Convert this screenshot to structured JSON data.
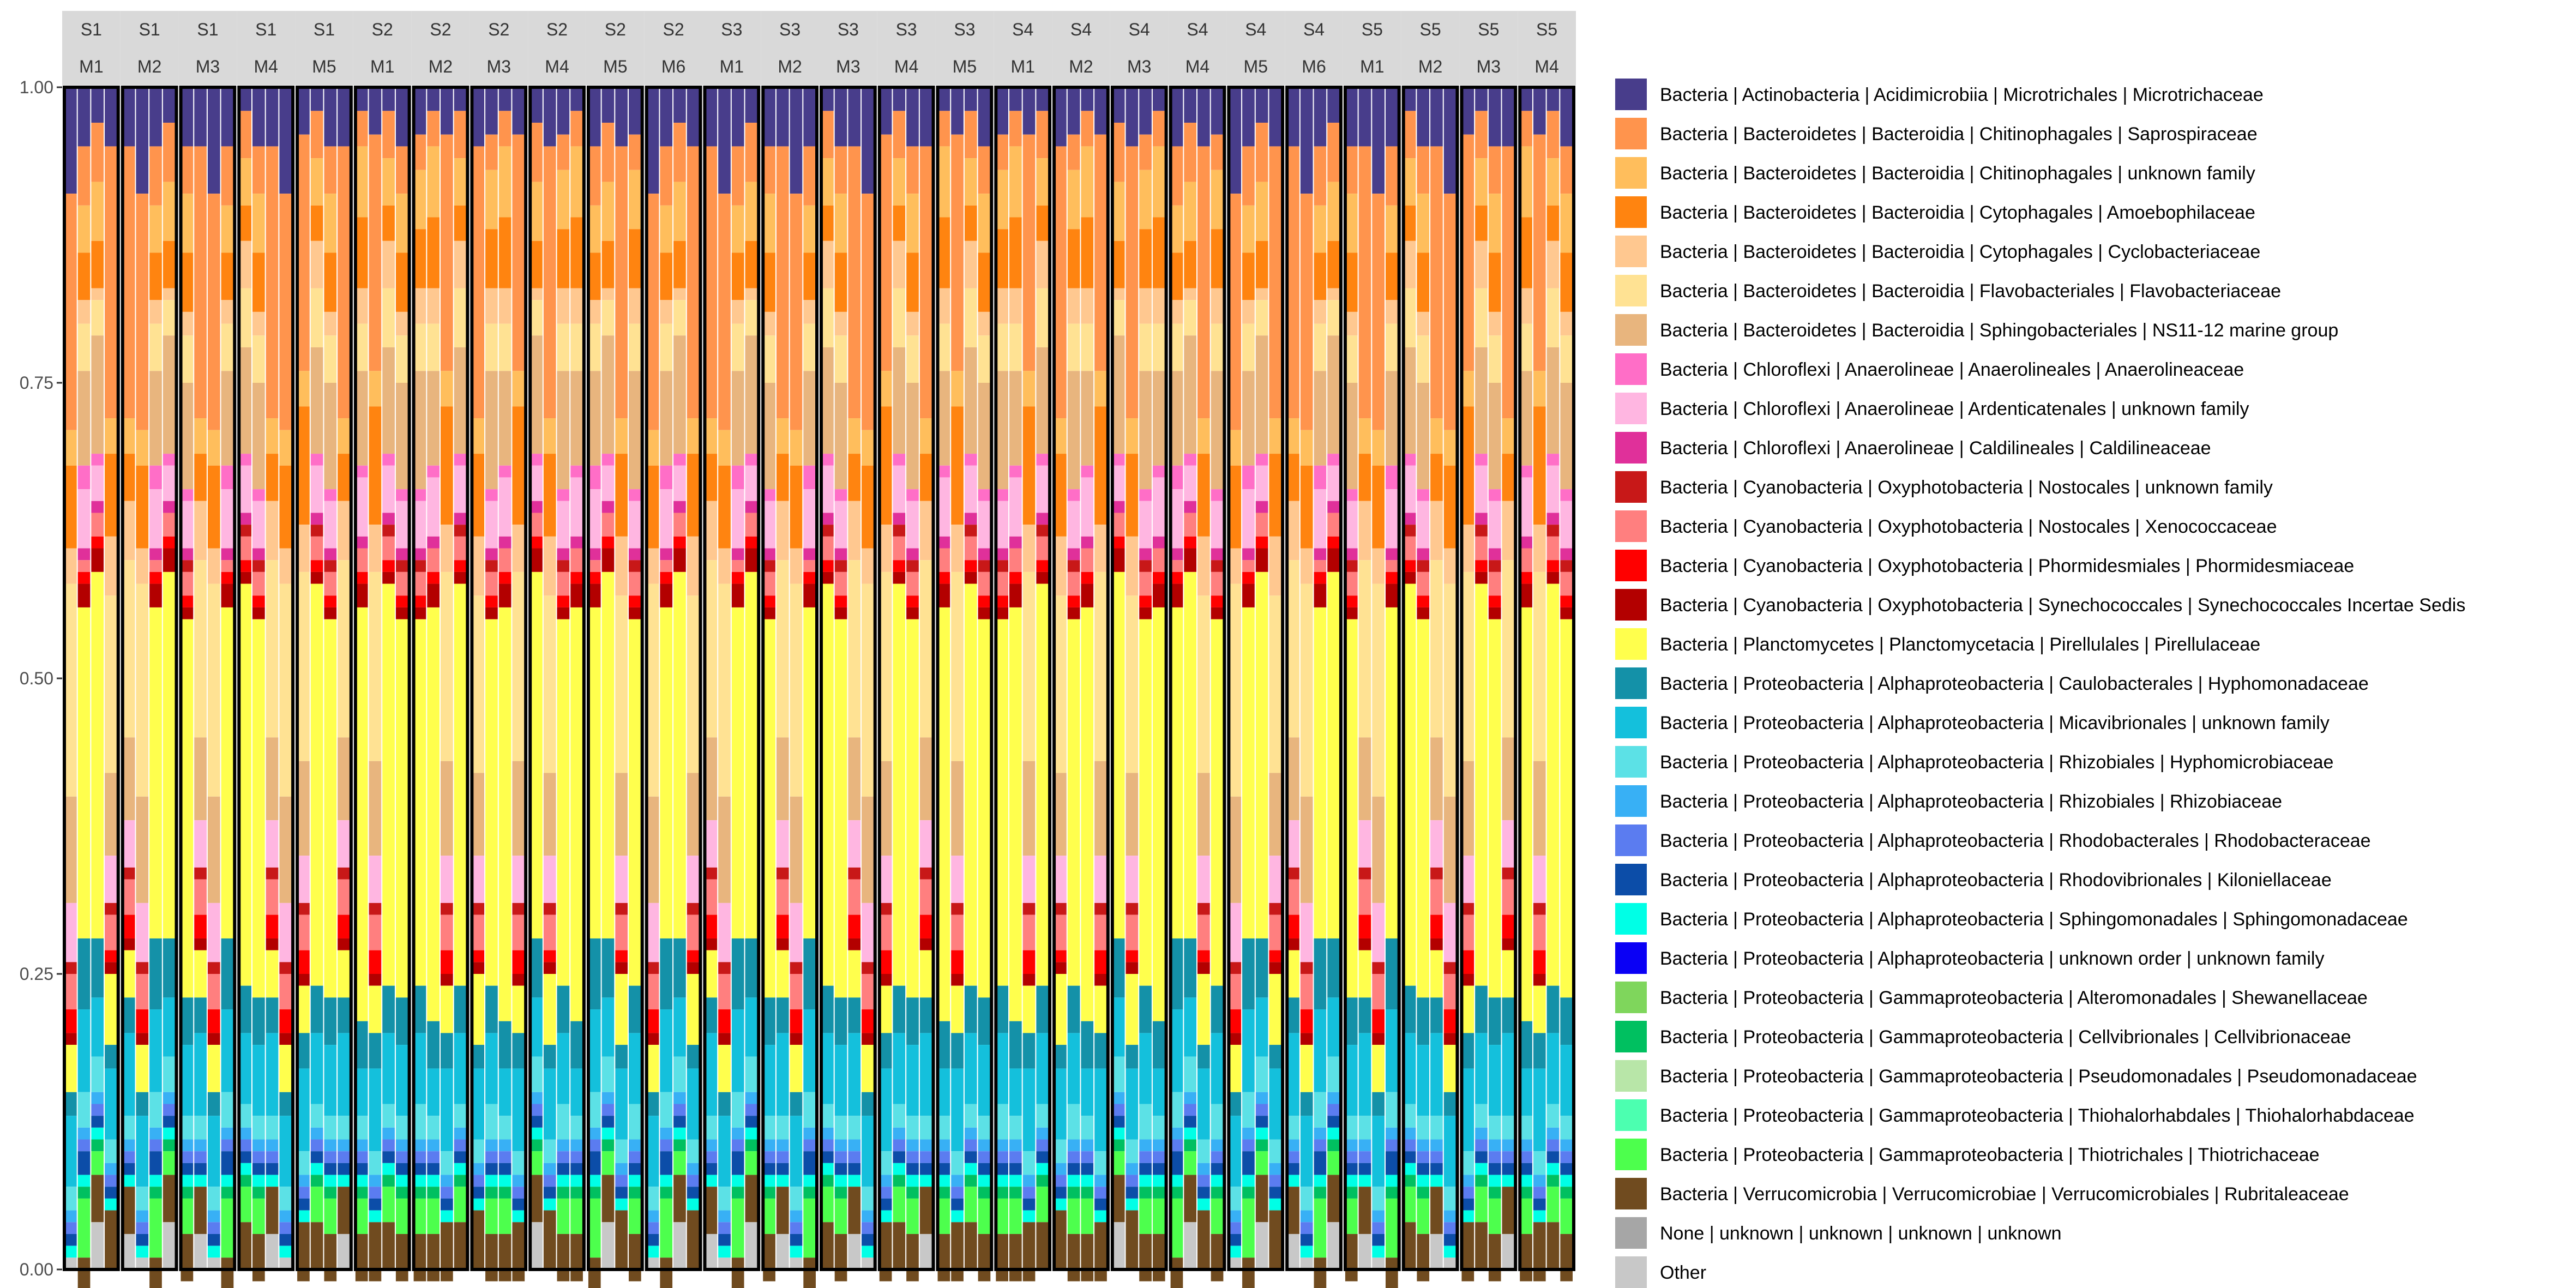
{
  "chart_data": {
    "type": "bar",
    "stacked": true,
    "ylim": [
      0,
      1
    ],
    "y_ticks": [
      "0.00",
      "0.25",
      "0.50",
      "0.75",
      "1.00"
    ],
    "grid": false,
    "legend_position": "right",
    "facet_labels": [
      [
        "S1",
        "M1"
      ],
      [
        "S1",
        "M2"
      ],
      [
        "S1",
        "M3"
      ],
      [
        "S1",
        "M4"
      ],
      [
        "S1",
        "M5"
      ],
      [
        "S2",
        "M1"
      ],
      [
        "S2",
        "M2"
      ],
      [
        "S2",
        "M3"
      ],
      [
        "S2",
        "M4"
      ],
      [
        "S2",
        "M5"
      ],
      [
        "S2",
        "M6"
      ],
      [
        "S3",
        "M1"
      ],
      [
        "S3",
        "M2"
      ],
      [
        "S3",
        "M3"
      ],
      [
        "S3",
        "M4"
      ],
      [
        "S3",
        "M5"
      ],
      [
        "S4",
        "M1"
      ],
      [
        "S4",
        "M2"
      ],
      [
        "S4",
        "M3"
      ],
      [
        "S4",
        "M4"
      ],
      [
        "S4",
        "M5"
      ],
      [
        "S4",
        "M6"
      ],
      [
        "S5",
        "M1"
      ],
      [
        "S5",
        "M2"
      ],
      [
        "S5",
        "M3"
      ],
      [
        "S5",
        "M4"
      ]
    ],
    "legend": [
      {
        "label": "Bacteria | Actinobacteria | Acidimicrobiia | Microtrichales | Microtrichaceae",
        "color": "#483D8B"
      },
      {
        "label": "Bacteria | Bacteroidetes | Bacteroidia | Chitinophagales | Saprospiraceae",
        "color": "#FF944D"
      },
      {
        "label": "Bacteria | Bacteroidetes | Bacteroidia | Chitinophagales | unknown family",
        "color": "#FFBE5C"
      },
      {
        "label": "Bacteria | Bacteroidetes | Bacteroidia | Cytophagales | Amoebophilaceae",
        "color": "#FF8410"
      },
      {
        "label": "Bacteria | Bacteroidetes | Bacteroidia | Cytophagales | Cyclobacteriaceae",
        "color": "#FFC890"
      },
      {
        "label": "Bacteria | Bacteroidetes | Bacteroidia | Flavobacteriales | Flavobacteriaceae",
        "color": "#FFE293"
      },
      {
        "label": "Bacteria | Bacteroidetes | Bacteroidia | Sphingobacteriales | NS11-12 marine group",
        "color": "#E8B57E"
      },
      {
        "label": "Bacteria | Chloroflexi | Anaerolineae | Anaerolineales | Anaerolineaceae",
        "color": "#FF6EC7"
      },
      {
        "label": "Bacteria | Chloroflexi | Anaerolineae | Ardenticatenales | unknown family",
        "color": "#FFB6E1"
      },
      {
        "label": "Bacteria | Chloroflexi | Anaerolineae | Caldilineales | Caldilineaceae",
        "color": "#E0309A"
      },
      {
        "label": "Bacteria | Cyanobacteria | Oxyphotobacteria | Nostocales | unknown family",
        "color": "#C81818"
      },
      {
        "label": "Bacteria | Cyanobacteria | Oxyphotobacteria | Nostocales | Xenococcaceae",
        "color": "#FF7F7F"
      },
      {
        "label": "Bacteria | Cyanobacteria | Oxyphotobacteria | Phormidesmiales | Phormidesmiaceae",
        "color": "#FF0000"
      },
      {
        "label": "Bacteria | Cyanobacteria | Oxyphotobacteria | Synechococcales | Synechococcales Incertae Sedis",
        "color": "#B30000"
      },
      {
        "label": "Bacteria | Planctomycetes | Planctomycetacia | Pirellulales | Pirellulaceae",
        "color": "#FFFF4D"
      },
      {
        "label": "Bacteria | Proteobacteria | Alphaproteobacteria | Caulobacterales | Hyphomonadaceae",
        "color": "#1491A8"
      },
      {
        "label": "Bacteria | Proteobacteria | Alphaproteobacteria | Micavibrionales | unknown family",
        "color": "#14C0DC"
      },
      {
        "label": "Bacteria | Proteobacteria | Alphaproteobacteria | Rhizobiales | Hyphomicrobiaceae",
        "color": "#5CE1E6"
      },
      {
        "label": "Bacteria | Proteobacteria | Alphaproteobacteria | Rhizobiales | Rhizobiaceae",
        "color": "#38B0F5"
      },
      {
        "label": "Bacteria | Proteobacteria | Alphaproteobacteria | Rhodobacterales | Rhodobacteraceae",
        "color": "#5B7CF0"
      },
      {
        "label": "Bacteria | Proteobacteria | Alphaproteobacteria | Rhodovibrionales | Kiloniellaceae",
        "color": "#0C4DA8"
      },
      {
        "label": "Bacteria | Proteobacteria | Alphaproteobacteria | Sphingomonadales | Sphingomonadaceae",
        "color": "#00FFE6"
      },
      {
        "label": "Bacteria | Proteobacteria | Alphaproteobacteria | unknown order | unknown family",
        "color": "#0A00F5"
      },
      {
        "label": "Bacteria | Proteobacteria | Gammaproteobacteria | Alteromonadales | Shewanellaceae",
        "color": "#7FD65C"
      },
      {
        "label": "Bacteria | Proteobacteria | Gammaproteobacteria | Cellvibrionales | Cellvibrionaceae",
        "color": "#00C060"
      },
      {
        "label": "Bacteria | Proteobacteria | Gammaproteobacteria | Pseudomonadales | Pseudomonadaceae",
        "color": "#B8E6A8"
      },
      {
        "label": "Bacteria | Proteobacteria | Gammaproteobacteria | Thiohalorhabdales | Thiohalorhabdaceae",
        "color": "#4CFFB0"
      },
      {
        "label": "Bacteria | Proteobacteria | Gammaproteobacteria | Thiotrichales | Thiotrichaceae",
        "color": "#4DFF4D"
      },
      {
        "label": "Bacteria | Verrucomicrobia | Verrucomicrobiae | Verrucomicrobiales | Rubritaleaceae",
        "color": "#704B1F"
      },
      {
        "label": "None | unknown | unknown | unknown | unknown",
        "color": "#A6A6A6"
      },
      {
        "label": "Other",
        "color": "#C8C8C8"
      }
    ],
    "samples": [
      [
        0.09,
        0.2,
        0.03,
        0.07,
        0.03,
        0.18,
        0.09,
        0,
        0.05,
        0,
        0.01,
        0.03,
        0.02,
        0.01,
        0.04,
        0.02,
        0.06,
        0.02,
        0.01,
        0.01,
        0.01,
        0.01,
        0,
        0,
        0,
        0,
        0,
        0,
        0,
        0,
        0
      ],
      [
        0.05,
        0.23,
        0.03,
        0.07,
        0.05,
        0.15,
        0.07,
        0,
        0.04,
        0,
        0.01,
        0.03,
        0.01,
        0.01,
        0.06,
        0.02,
        0.06,
        0.02,
        0.01,
        0.01,
        0.01,
        0.01,
        0,
        0,
        0,
        0,
        0,
        0,
        0.05,
        0,
        0
      ],
      [
        0.04,
        0.2,
        0.03,
        0.1,
        0.04,
        0.16,
        0.08,
        0,
        0.04,
        0,
        0.01,
        0.03,
        0.02,
        0.01,
        0.04,
        0.03,
        0.07,
        0.02,
        0.01,
        0.01,
        0.01,
        0.01,
        0,
        0,
        0,
        0,
        0,
        0,
        0.05,
        0,
        0
      ],
      [
        0.05,
        0.23,
        0.03,
        0.04,
        0.05,
        0.15,
        0.07,
        0,
        0.04,
        0,
        0.01,
        0.03,
        0.02,
        0.01,
        0.04,
        0.03,
        0.07,
        0.02,
        0.01,
        0.01,
        0.01,
        0.01,
        0,
        0,
        0,
        0,
        0,
        0,
        0.04,
        0,
        0
      ],
      [
        0.03,
        0.05,
        0.05,
        0.04,
        0.01,
        0.03,
        0.1,
        0.01,
        0.03,
        0.01,
        0,
        0.02,
        0.01,
        0.02,
        0.31,
        0.05,
        0.05,
        0.03,
        0.01,
        0.01,
        0.01,
        0.01,
        0,
        0,
        0.01,
        0,
        0,
        0.02,
        0.04,
        0,
        0
      ],
      [
        0.02,
        0.03,
        0.06,
        0.06,
        0.03,
        0.04,
        0.08,
        0.01,
        0.05,
        0.01,
        0,
        0.02,
        0.01,
        0.02,
        0.35,
        0.04,
        0.04,
        0.02,
        0.01,
        0.01,
        0.01,
        0.01,
        0,
        0,
        0.01,
        0,
        0,
        0.03,
        0.04,
        0,
        0
      ],
      [
        0.05,
        0.04,
        0.05,
        0.05,
        0.02,
        0.04,
        0.09,
        0.01,
        0.04,
        0.01,
        0.01,
        0.02,
        0.01,
        0.01,
        0.32,
        0.04,
        0.06,
        0.02,
        0.01,
        0.01,
        0.01,
        0.01,
        0,
        0,
        0.01,
        0,
        0,
        0.03,
        0.04,
        0,
        0
      ],
      [
        0.05,
        0.05,
        0.04,
        0.04,
        0.02,
        0.04,
        0.08,
        0.02,
        0.05,
        0.01,
        0,
        0.01,
        0.01,
        0.02,
        0.28,
        0.06,
        0.07,
        0.03,
        0.01,
        0.01,
        0.02,
        0.01,
        0,
        0,
        0.01,
        0,
        0,
        0.05,
        0.05,
        0.01,
        0.02
      ],
      [
        0.04,
        0.03,
        0.05,
        0.05,
        0.03,
        0.04,
        0.1,
        0.01,
        0.04,
        0.01,
        0.01,
        0.02,
        0.01,
        0.01,
        0.31,
        0.04,
        0.06,
        0.03,
        0.01,
        0.01,
        0.01,
        0.01,
        0,
        0,
        0.01,
        0,
        0,
        0.03,
        0.04,
        0,
        0
      ],
      [
        0.02,
        0.04,
        0.04,
        0.03,
        0.04,
        0.05,
        0.09,
        0.01,
        0.04,
        0.01,
        0.01,
        0.02,
        0.01,
        0.01,
        0.34,
        0.04,
        0.06,
        0.02,
        0.01,
        0.01,
        0.01,
        0.01,
        0,
        0,
        0.01,
        0,
        0,
        0.03,
        0.04,
        0,
        0
      ]
    ]
  },
  "y_tick_labels": [
    "0.00",
    "0.25",
    "0.50",
    "0.75",
    "1.00"
  ]
}
